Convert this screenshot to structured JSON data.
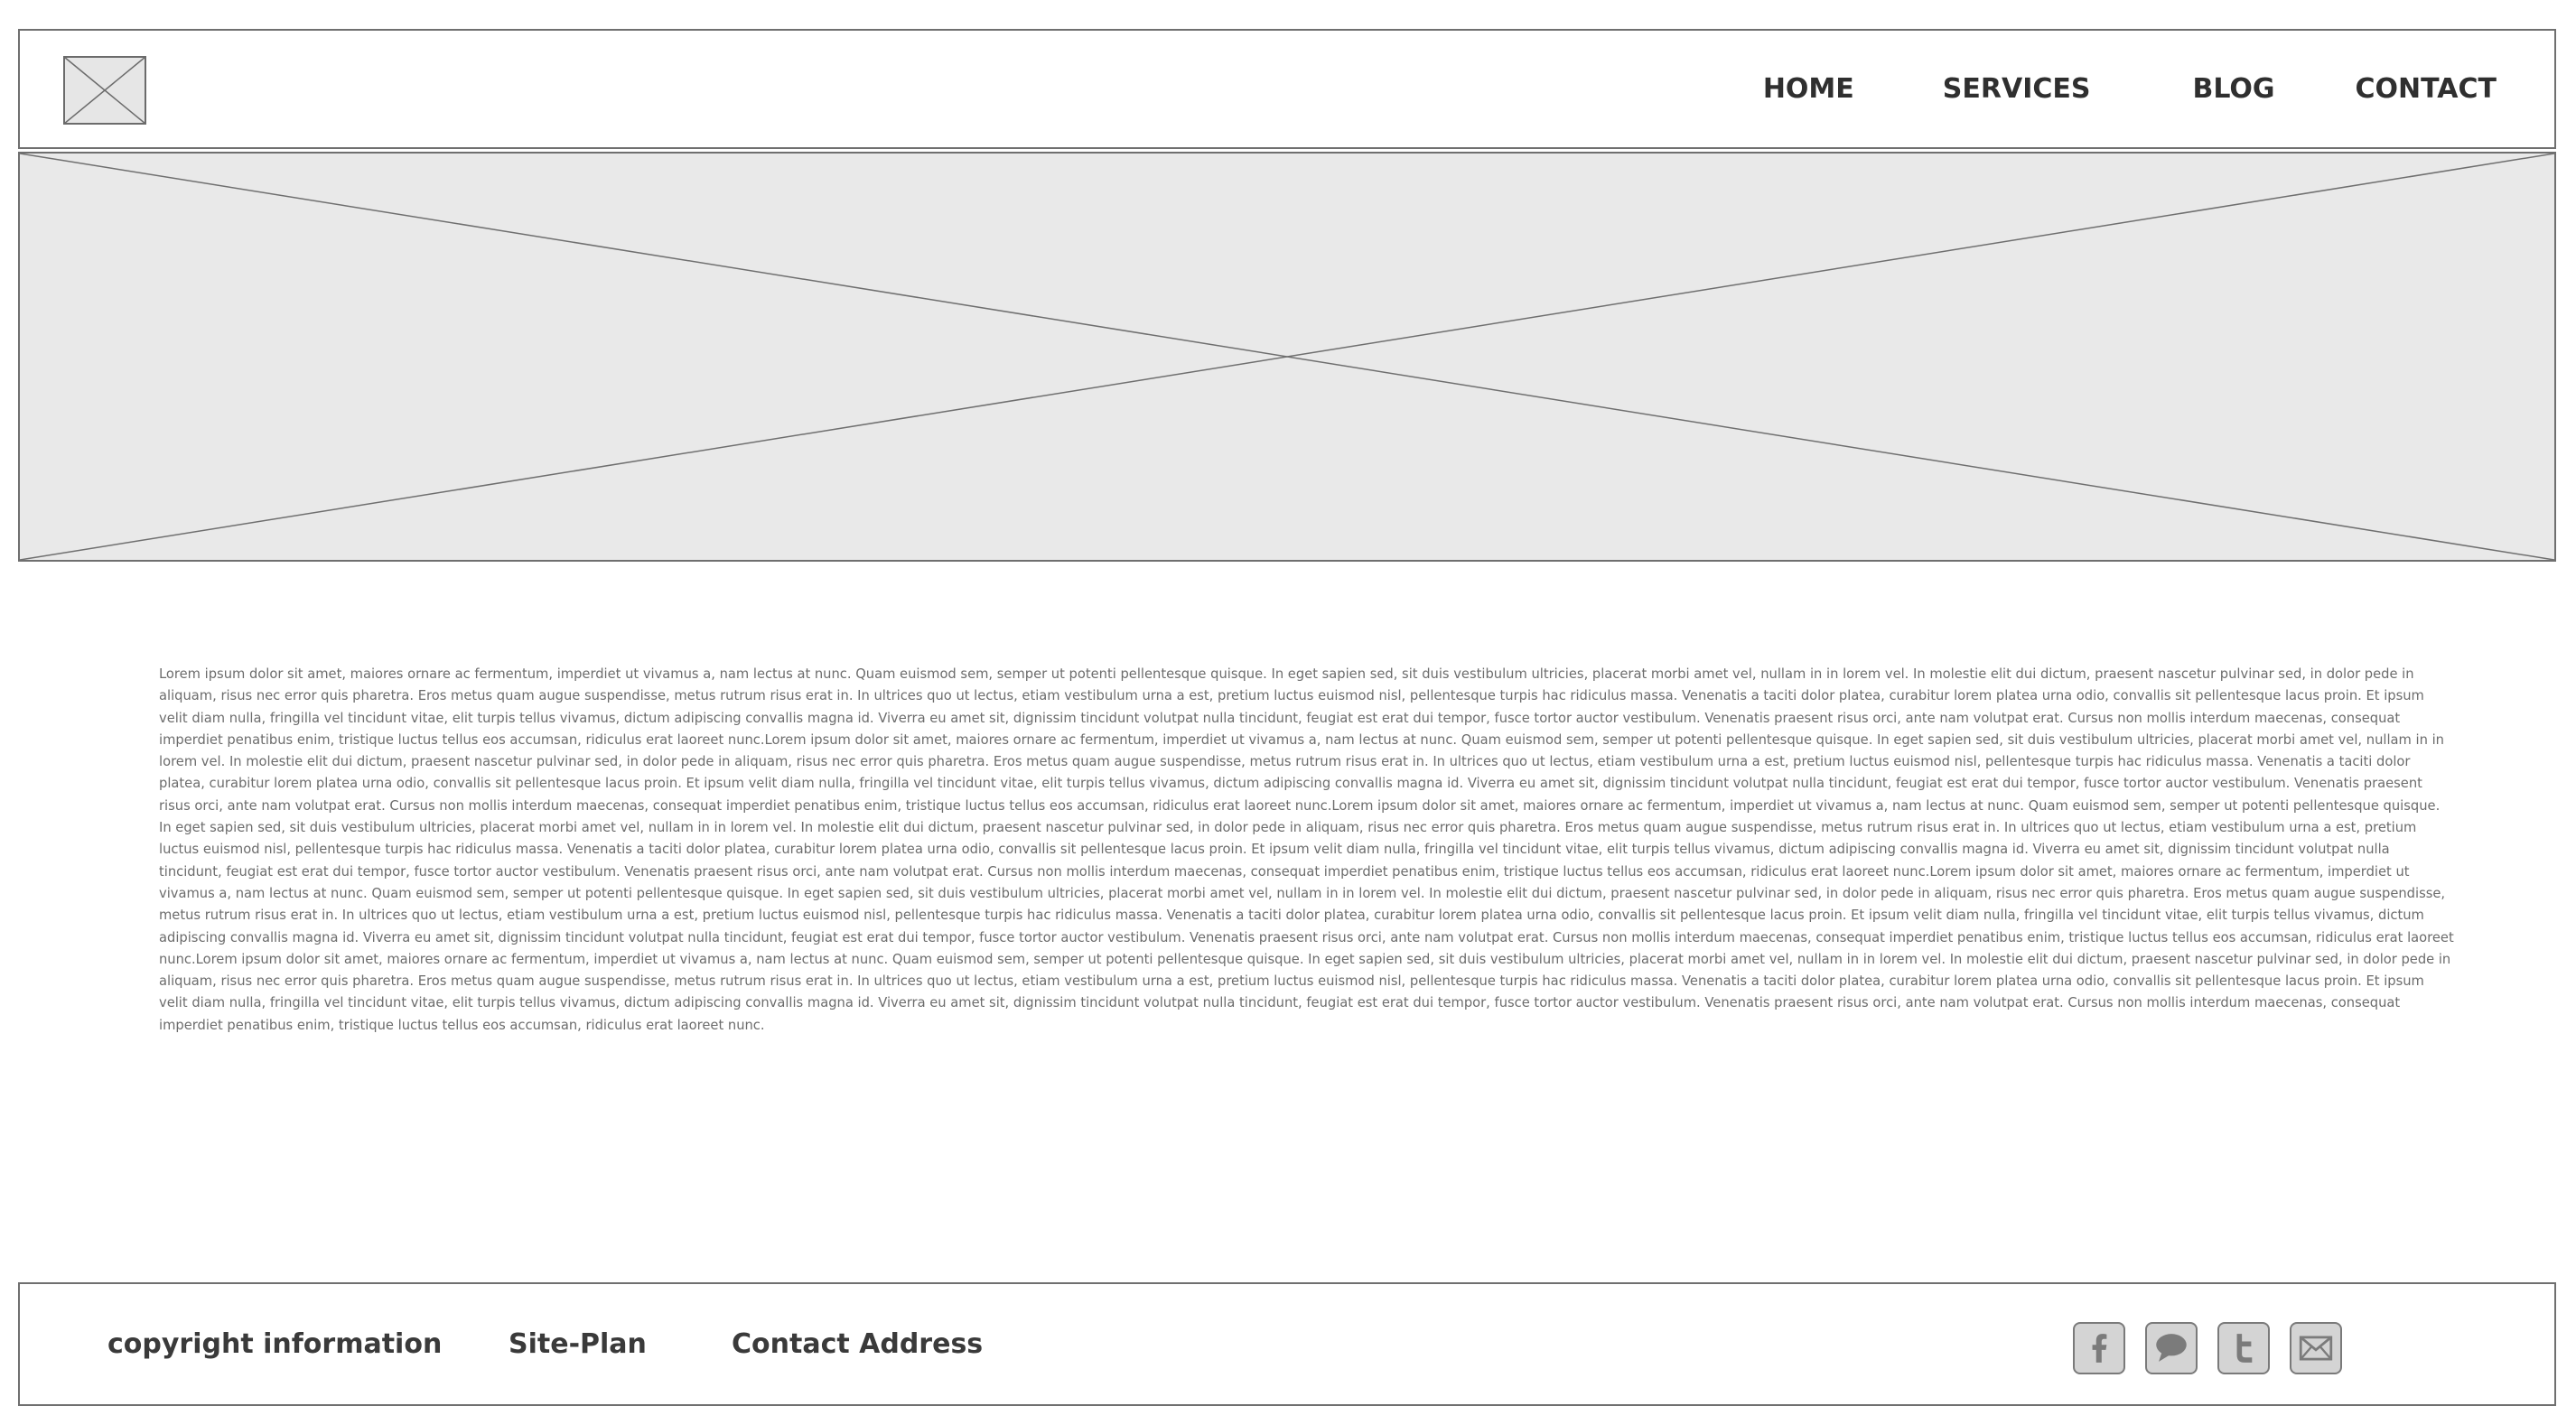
{
  "header": {
    "logo_icon": "image-placeholder-icon",
    "nav": [
      {
        "label": "HOME"
      },
      {
        "label": "SERVICES"
      },
      {
        "label": "BLOG"
      },
      {
        "label": "CONTACT"
      }
    ]
  },
  "hero": {
    "icon": "image-placeholder-icon",
    "background": "#e9e9e9"
  },
  "content": {
    "body": "Lorem ipsum dolor sit amet, maiores ornare ac fermentum, imperdiet ut vivamus a, nam lectus at nunc. Quam euismod sem, semper ut potenti pellentesque quisque. In eget sapien sed, sit duis vestibulum ultricies, placerat morbi amet vel, nullam in in lorem vel. In molestie elit dui dictum, praesent nascetur pulvinar sed, in dolor pede in aliquam, risus nec error quis pharetra. Eros metus quam augue suspendisse, metus rutrum risus erat in.  In ultrices quo ut lectus, etiam vestibulum urna a est, pretium luctus euismod nisl, pellentesque turpis hac ridiculus massa. Venenatis a taciti dolor platea, curabitur lorem platea urna odio, convallis sit pellentesque lacus proin. Et ipsum velit diam nulla, fringilla vel tincidunt vitae, elit turpis tellus vivamus, dictum adipiscing convallis magna id. Viverra eu amet sit, dignissim tincidunt volutpat nulla tincidunt, feugiat est erat dui tempor, fusce tortor auctor vestibulum. Venenatis praesent risus orci, ante nam volutpat erat. Cursus non mollis interdum maecenas, consequat imperdiet penatibus enim, tristique luctus tellus eos accumsan, ridiculus erat laoreet nunc.Lorem ipsum dolor sit amet, maiores ornare ac fermentum, imperdiet ut vivamus a, nam lectus at nunc. Quam euismod sem, semper ut potenti pellentesque quisque. In eget sapien sed, sit duis vestibulum ultricies, placerat morbi amet vel, nullam in in lorem vel. In molestie elit dui dictum, praesent nascetur pulvinar sed, in dolor pede in aliquam, risus nec error quis pharetra. Eros metus quam augue suspendisse, metus rutrum risus erat in.  In ultrices quo ut lectus, etiam vestibulum urna a est, pretium luctus euismod nisl, pellentesque turpis hac ridiculus massa. Venenatis a taciti dolor platea, curabitur lorem platea urna odio, convallis sit pellentesque lacus proin. Et ipsum velit diam nulla, fringilla vel tincidunt vitae, elit turpis tellus vivamus, dictum adipiscing convallis magna id. Viverra eu amet sit, dignissim tincidunt volutpat nulla tincidunt, feugiat est erat dui tempor, fusce tortor auctor vestibulum. Venenatis praesent risus orci, ante nam volutpat erat. Cursus non mollis interdum maecenas, consequat imperdiet penatibus enim, tristique luctus tellus eos accumsan, ridiculus erat laoreet nunc.Lorem ipsum dolor sit amet, maiores ornare ac fermentum, imperdiet ut vivamus a, nam lectus at nunc. Quam euismod sem, semper ut potenti pellentesque quisque. In eget sapien sed, sit duis vestibulum ultricies, placerat morbi amet vel, nullam in in lorem vel. In molestie elit dui dictum, praesent nascetur pulvinar sed, in dolor pede in aliquam, risus nec error quis pharetra. Eros metus quam augue suspendisse, metus rutrum risus erat in.  In ultrices quo ut lectus, etiam vestibulum urna a est, pretium luctus euismod nisl, pellentesque turpis hac ridiculus massa. Venenatis a taciti dolor platea, curabitur lorem platea urna odio, convallis sit pellentesque lacus proin. Et ipsum velit diam nulla, fringilla vel tincidunt vitae, elit turpis tellus vivamus, dictum adipiscing convallis magna id. Viverra eu amet sit, dignissim tincidunt volutpat nulla tincidunt, feugiat est erat dui tempor, fusce tortor auctor vestibulum. Venenatis praesent risus orci, ante nam volutpat erat. Cursus non mollis interdum maecenas, consequat imperdiet penatibus enim, tristique luctus tellus eos accumsan, ridiculus erat laoreet nunc.Lorem ipsum dolor sit amet, maiores ornare ac fermentum, imperdiet ut vivamus a, nam lectus at nunc. Quam euismod sem, semper ut potenti pellentesque quisque. In eget sapien sed, sit duis vestibulum ultricies, placerat morbi amet vel, nullam in in lorem vel. In molestie elit dui dictum, praesent nascetur pulvinar sed, in dolor pede in aliquam, risus nec error quis pharetra. Eros metus quam augue suspendisse, metus rutrum risus erat in.  In ultrices quo ut lectus, etiam vestibulum urna a est, pretium luctus euismod nisl, pellentesque turpis hac ridiculus massa. Venenatis a taciti dolor platea, curabitur lorem platea urna odio, convallis sit pellentesque lacus proin. Et ipsum velit diam nulla, fringilla vel tincidunt vitae, elit turpis tellus vivamus, dictum adipiscing convallis magna id. Viverra eu amet sit, dignissim tincidunt volutpat nulla tincidunt, feugiat est erat dui tempor, fusce tortor auctor vestibulum. Venenatis praesent risus orci, ante nam volutpat erat. Cursus non mollis interdum maecenas, consequat imperdiet penatibus enim, tristique luctus tellus eos accumsan, ridiculus erat laoreet nunc.Lorem ipsum dolor sit amet, maiores ornare ac fermentum, imperdiet ut vivamus a, nam lectus at nunc. Quam euismod sem, semper ut potenti pellentesque quisque. In eget sapien sed, sit duis vestibulum ultricies, placerat morbi amet vel, nullam in in lorem vel. In molestie elit dui dictum, praesent nascetur pulvinar sed, in dolor pede in aliquam, risus nec error quis pharetra. Eros metus quam augue suspendisse, metus rutrum risus erat in.  In ultrices quo ut lectus, etiam vestibulum urna a est, pretium luctus euismod nisl, pellentesque turpis hac ridiculus massa. Venenatis a taciti dolor platea, curabitur lorem platea urna odio, convallis sit pellentesque lacus proin. Et ipsum velit diam nulla, fringilla vel tincidunt vitae, elit turpis tellus vivamus, dictum adipiscing convallis magna id. Viverra eu amet sit, dignissim tincidunt volutpat nulla tincidunt, feugiat est erat dui tempor, fusce tortor auctor vestibulum. Venenatis praesent risus orci, ante nam volutpat erat. Cursus non mollis interdum maecenas, consequat imperdiet penatibus enim, tristique luctus tellus eos accumsan, ridiculus erat laoreet nunc."
  },
  "footer": {
    "copyright": "copyright information",
    "site_plan": "Site-Plan",
    "contact_address": "Contact Address",
    "social_icons": [
      "facebook-icon",
      "chat-bubble-icon",
      "twitter-icon",
      "mail-icon"
    ]
  },
  "colors": {
    "frame_border": "#6f6f6f",
    "placeholder_fill": "#e9e9e9",
    "icon_fill": "#d4d4d4",
    "text_dark": "#2f2f2f",
    "text_body": "#6c6c6c"
  }
}
